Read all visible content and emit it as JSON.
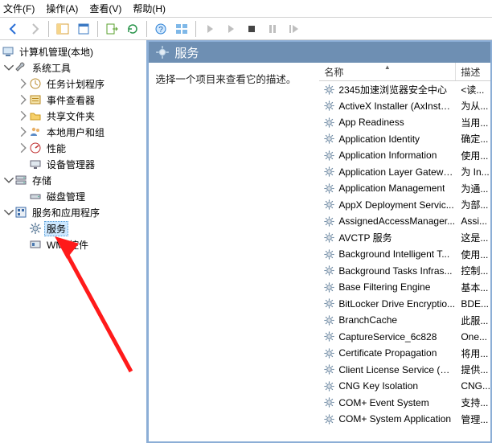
{
  "menu": {
    "file": "文件(F)",
    "action": "操作(A)",
    "view": "查看(V)",
    "help": "帮助(H)"
  },
  "tree": {
    "root": "计算机管理(本地)",
    "system_tools": "系统工具",
    "task_scheduler": "任务计划程序",
    "event_viewer": "事件查看器",
    "shared_folders": "共享文件夹",
    "local_users": "本地用户和组",
    "performance": "性能",
    "device_manager": "设备管理器",
    "storage": "存储",
    "disk_management": "磁盘管理",
    "services_apps": "服务和应用程序",
    "services": "服务",
    "wmi": "WMI 控件"
  },
  "right": {
    "header": "服务",
    "desc": "选择一个项目来查看它的描述。",
    "col_name": "名称",
    "col_desc": "描述"
  },
  "services": [
    {
      "name": "2345加速浏览器安全中心",
      "desc": "<读..."
    },
    {
      "name": "ActiveX Installer (AxInstSV)",
      "desc": "为从..."
    },
    {
      "name": "App Readiness",
      "desc": "当用..."
    },
    {
      "name": "Application Identity",
      "desc": "确定..."
    },
    {
      "name": "Application Information",
      "desc": "使用..."
    },
    {
      "name": "Application Layer Gatewa...",
      "desc": "为 In..."
    },
    {
      "name": "Application Management",
      "desc": "为通..."
    },
    {
      "name": "AppX Deployment Servic...",
      "desc": "为部..."
    },
    {
      "name": "AssignedAccessManager...",
      "desc": "Assi..."
    },
    {
      "name": "AVCTP 服务",
      "desc": "这是..."
    },
    {
      "name": "Background Intelligent T...",
      "desc": "使用..."
    },
    {
      "name": "Background Tasks Infras...",
      "desc": "控制..."
    },
    {
      "name": "Base Filtering Engine",
      "desc": "基本..."
    },
    {
      "name": "BitLocker Drive Encryptio...",
      "desc": "BDE..."
    },
    {
      "name": "BranchCache",
      "desc": "此服..."
    },
    {
      "name": "CaptureService_6c828",
      "desc": "One..."
    },
    {
      "name": "Certificate Propagation",
      "desc": "将用..."
    },
    {
      "name": "Client License Service (Cli...",
      "desc": "提供..."
    },
    {
      "name": "CNG Key Isolation",
      "desc": "CNG..."
    },
    {
      "name": "COM+ Event System",
      "desc": "支持..."
    },
    {
      "name": "COM+ System Application",
      "desc": "管理..."
    }
  ]
}
